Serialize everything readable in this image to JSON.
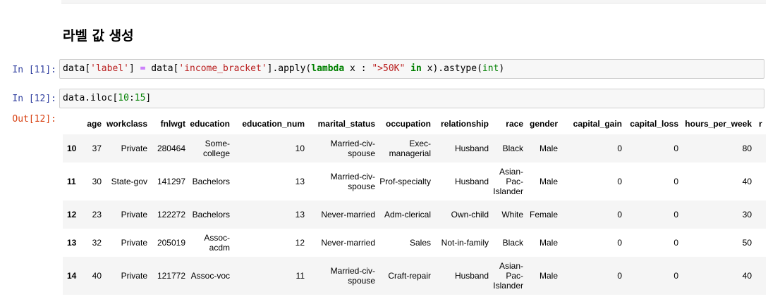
{
  "heading": "라벨 값 생성",
  "cells": {
    "c11": {
      "prompt": "In [11]:",
      "code": [
        {
          "t": "",
          "v": "data["
        },
        {
          "t": "tok-str",
          "v": "'label'"
        },
        {
          "t": "",
          "v": "] "
        },
        {
          "t": "tok-op",
          "v": "="
        },
        {
          "t": "",
          "v": " data["
        },
        {
          "t": "tok-str",
          "v": "'income_bracket'"
        },
        {
          "t": "",
          "v": "].apply("
        },
        {
          "t": "tok-kw",
          "v": "lambda"
        },
        {
          "t": "",
          "v": " x : "
        },
        {
          "t": "tok-str",
          "v": "\">50K\""
        },
        {
          "t": "",
          "v": " "
        },
        {
          "t": "tok-kw",
          "v": "in"
        },
        {
          "t": "",
          "v": " x).astype("
        },
        {
          "t": "tok-builtin",
          "v": "int"
        },
        {
          "t": "",
          "v": ")"
        }
      ]
    },
    "c12": {
      "prompt": "In [12]:",
      "out_prompt": "Out[12]:",
      "code": [
        {
          "t": "",
          "v": "data.iloc["
        },
        {
          "t": "tok-num",
          "v": "10"
        },
        {
          "t": "",
          "v": ":"
        },
        {
          "t": "tok-num",
          "v": "15"
        },
        {
          "t": "",
          "v": "]"
        }
      ]
    }
  },
  "dataframe": {
    "columns": [
      "",
      "age",
      "workclass",
      "fnlwgt",
      "education",
      "education_num",
      "marital_status",
      "occupation",
      "relationship",
      "race",
      "gender",
      "capital_gain",
      "capital_loss",
      "hours_per_week",
      "r"
    ],
    "rows": [
      {
        "index": "10",
        "cells": [
          "37",
          "Private",
          "280464",
          "Some-college",
          "10",
          "Married-civ-spouse",
          "Exec-managerial",
          "Husband",
          "Black",
          "Male",
          "0",
          "0",
          "80",
          ""
        ]
      },
      {
        "index": "11",
        "cells": [
          "30",
          "State-gov",
          "141297",
          "Bachelors",
          "13",
          "Married-civ-spouse",
          "Prof-specialty",
          "Husband",
          "Asian-Pac-Islander",
          "Male",
          "0",
          "0",
          "40",
          ""
        ]
      },
      {
        "index": "12",
        "cells": [
          "23",
          "Private",
          "122272",
          "Bachelors",
          "13",
          "Never-married",
          "Adm-clerical",
          "Own-child",
          "White",
          "Female",
          "0",
          "0",
          "30",
          ""
        ]
      },
      {
        "index": "13",
        "cells": [
          "32",
          "Private",
          "205019",
          "Assoc-acdm",
          "12",
          "Never-married",
          "Sales",
          "Not-in-family",
          "Black",
          "Male",
          "0",
          "0",
          "50",
          ""
        ]
      },
      {
        "index": "14",
        "cells": [
          "40",
          "Private",
          "121772",
          "Assoc-voc",
          "11",
          "Married-civ-spouse",
          "Craft-repair",
          "Husband",
          "Asian-Pac-Islander",
          "Male",
          "0",
          "0",
          "40",
          ""
        ]
      }
    ]
  }
}
